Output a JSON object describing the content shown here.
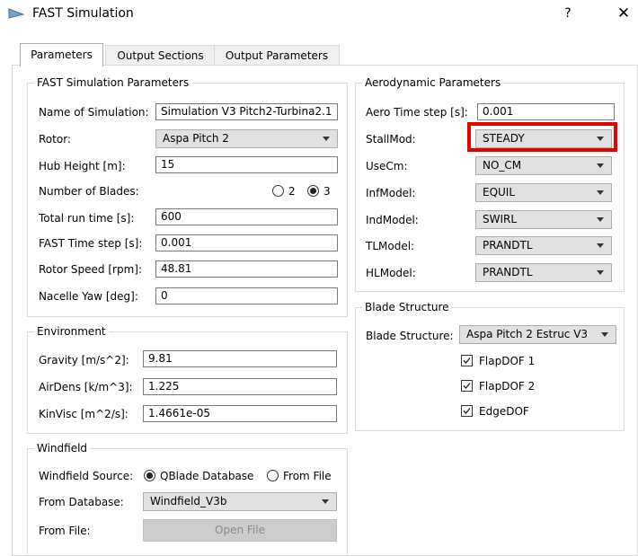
{
  "window": {
    "title": "FAST Simulation",
    "help": "?",
    "close": "✕"
  },
  "tabs": [
    {
      "label": "Parameters",
      "active": true
    },
    {
      "label": "Output Sections",
      "active": false
    },
    {
      "label": "Output Parameters",
      "active": false
    }
  ],
  "fast_sim": {
    "title": "FAST Simulation Parameters",
    "name_label": "Name of Simulation:",
    "name_value": "Simulation V3 Pitch2-Turbina2.1",
    "rotor_label": "Rotor:",
    "rotor_value": "Aspa Pitch 2",
    "hub_label": "Hub Height [m]:",
    "hub_value": "15",
    "blades_label": "Number of Blades:",
    "blades_option_2": "2",
    "blades_option_3": "3",
    "blades_selected": "3",
    "runtime_label": "Total run time [s]:",
    "runtime_value": "600",
    "timestep_label": "FAST Time step [s]:",
    "timestep_value": "0.001",
    "speed_label": "Rotor Speed [rpm]:",
    "speed_value": "48.81",
    "yaw_label": "Nacelle Yaw [deg]:",
    "yaw_value": "0"
  },
  "environment": {
    "title": "Environment",
    "gravity_label": "Gravity [m/s^2]:",
    "gravity_value": "9.81",
    "airdens_label": "AirDens [k/m^3]:",
    "airdens_value": "1.225",
    "kinvisc_label": "KinVisc [m^2/s]:",
    "kinvisc_value": "1.4661e-05"
  },
  "windfield": {
    "title": "Windfield",
    "source_label": "Windfield Source:",
    "source_option_1": "QBlade Database",
    "source_option_2": "From File",
    "source_selected": "QBlade Database",
    "db_label": "From Database:",
    "db_value": "Windfield_V3b",
    "file_label": "From File:",
    "open_file": "Open File"
  },
  "aero": {
    "title": "Aerodynamic Parameters",
    "timestep_label": "Aero Time step [s]:",
    "timestep_value": "0.001",
    "stallmod_label": "StallMod:",
    "stallmod_value": "STEADY",
    "usecm_label": "UseCm:",
    "usecm_value": "NO_CM",
    "infmodel_label": "InfModel:",
    "infmodel_value": "EQUIL",
    "indmodel_label": "IndModel:",
    "indmodel_value": "SWIRL",
    "tlmodel_label": "TLModel:",
    "tlmodel_value": "PRANDTL",
    "hlmodel_label": "HLModel:",
    "hlmodel_value": "PRANDTL"
  },
  "blade_structure": {
    "title": "Blade Structure",
    "label": "Blade Structure:",
    "value": "Aspa Pitch 2 Estruc V3",
    "flap1": "FlapDOF 1",
    "flap2": "FlapDOF 2",
    "edge": "EdgeDOF",
    "flap1_checked": true,
    "flap2_checked": true,
    "edge_checked": true
  },
  "colors": {
    "highlight": "#e60000",
    "combo_bg": "#e1e1e1",
    "disabled_btn": "#cccccc"
  },
  "icons": {
    "app": "wind-turbine-icon",
    "help": "help-icon",
    "close": "close-icon"
  }
}
